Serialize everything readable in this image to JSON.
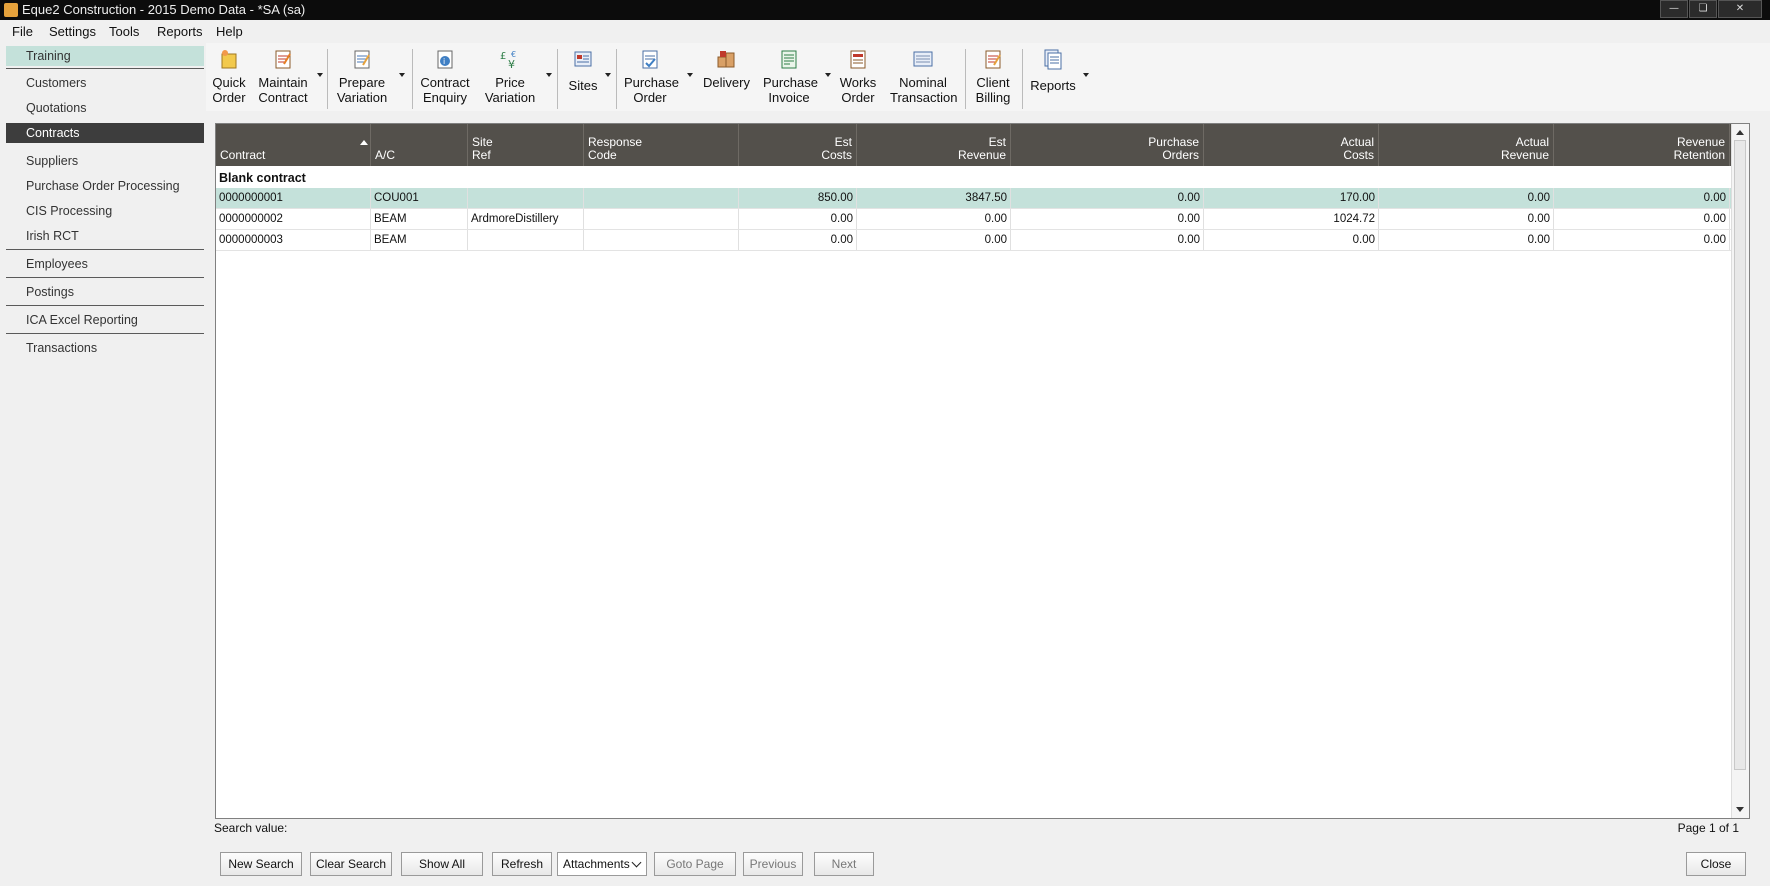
{
  "window": {
    "title": "Eque2 Construction - 2015 Demo Data - *SA (sa)"
  },
  "menu": [
    "File",
    "Settings",
    "Tools",
    "Reports",
    "Help"
  ],
  "sidebar": {
    "items": [
      "Training",
      "Customers",
      "Quotations",
      "Contracts",
      "Suppliers",
      "Purchase Order Processing",
      "CIS Processing",
      "Irish RCT",
      "Employees",
      "Postings",
      "ICA Excel Reporting",
      "Transactions"
    ],
    "active": "Contracts"
  },
  "toolbar": [
    {
      "line1": "Quick",
      "line2": "Order",
      "icon": "quick-order-icon"
    },
    {
      "line1": "Maintain",
      "line2": "Contract",
      "icon": "maintain-contract-icon"
    },
    {
      "line1": "Prepare",
      "line2": "Variation",
      "icon": "prepare-variation-icon"
    },
    {
      "line1": "Contract",
      "line2": "Enquiry",
      "icon": "contract-enquiry-icon"
    },
    {
      "line1": "Price",
      "line2": "Variation",
      "icon": "price-variation-icon"
    },
    {
      "line1": "Sites",
      "line2": "",
      "icon": "sites-icon"
    },
    {
      "line1": "Purchase",
      "line2": "Order",
      "icon": "purchase-order-icon"
    },
    {
      "line1": "Delivery",
      "line2": "",
      "icon": "delivery-icon"
    },
    {
      "line1": "Purchase",
      "line2": "Invoice",
      "icon": "purchase-invoice-icon"
    },
    {
      "line1": "Works",
      "line2": "Order",
      "icon": "works-order-icon"
    },
    {
      "line1": "Nominal",
      "line2": "Transaction",
      "icon": "nominal-transaction-icon"
    },
    {
      "line1": "Client",
      "line2": "Billing",
      "icon": "client-billing-icon"
    },
    {
      "line1": "Reports",
      "line2": "",
      "icon": "reports-icon"
    }
  ],
  "grid": {
    "columns": [
      {
        "l1": "",
        "l2": "Contract"
      },
      {
        "l1": "",
        "l2": "A/C"
      },
      {
        "l1": "Site",
        "l2": "Ref"
      },
      {
        "l1": "Response",
        "l2": "Code"
      },
      {
        "l1": "Est",
        "l2": "Costs"
      },
      {
        "l1": "Est",
        "l2": "Revenue"
      },
      {
        "l1": "Purchase",
        "l2": "Orders"
      },
      {
        "l1": "Actual",
        "l2": "Costs"
      },
      {
        "l1": "Actual",
        "l2": "Revenue"
      },
      {
        "l1": "Revenue",
        "l2": "Retention"
      }
    ],
    "group_label": "Blank contract",
    "rows": [
      [
        "0000000001",
        "COU001",
        "",
        "",
        "850.00",
        "3847.50",
        "0.00",
        "170.00",
        "0.00",
        "0.00"
      ],
      [
        "0000000002",
        "BEAM",
        "ArdmoreDistillery",
        "",
        "0.00",
        "0.00",
        "0.00",
        "1024.72",
        "0.00",
        "0.00"
      ],
      [
        "0000000003",
        "BEAM",
        "",
        "",
        "0.00",
        "0.00",
        "0.00",
        "0.00",
        "0.00",
        "0.00"
      ]
    ]
  },
  "footer": {
    "search_label": "Search value:",
    "page_info": "Page 1 of 1",
    "buttons": {
      "new_search": "New Search",
      "clear_search": "Clear Search",
      "show_all": "Show All",
      "refresh": "Refresh",
      "attachments": "Attachments",
      "goto_page": "Goto Page",
      "previous": "Previous",
      "next": "Next",
      "close": "Close"
    }
  }
}
